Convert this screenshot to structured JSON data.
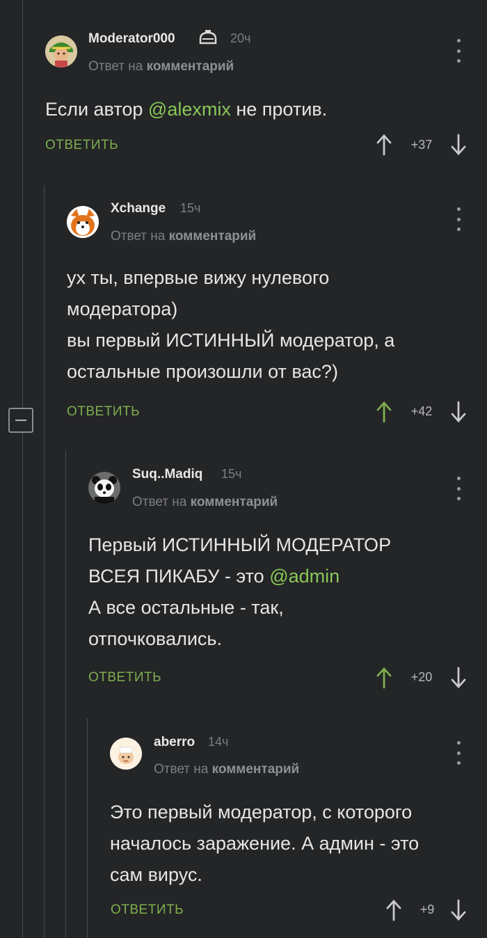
{
  "reply_label": "ОТВЕТИТЬ",
  "reply_prefix": "Ответ на",
  "reply_target": "комментарий",
  "comments": [
    {
      "username": "Moderator000",
      "time": "20ч",
      "lines": [
        "Если автор ",
        "@alexmix",
        " не против."
      ],
      "score": "+37"
    },
    {
      "username": "Xchange",
      "time": "15ч",
      "lines": [
        "ух ты, впервые вижу нулевого",
        "модератора)",
        "вы первый ИСТИННЫЙ модератор, а",
        "остальные произошли от вас?)"
      ],
      "score": "+42"
    },
    {
      "username": "Suq..Madiq",
      "time": "15ч",
      "lines": [
        "Первый ИСТИННЫЙ МОДЕРАТОР",
        "ВСЕЯ ПИКАБУ - это ",
        "@admin",
        "А все остальные - так,",
        "отпочковались."
      ],
      "score": "+20"
    },
    {
      "username": "aberro",
      "time": "14ч",
      "lines": [
        "Это первый модератор, с которого",
        "началось заражение. А админ - это",
        "сам вирус."
      ],
      "score": "+9"
    }
  ],
  "colors": {
    "background": "#232527",
    "accent_green": "#7fae4e",
    "mention_green": "#8ac858",
    "muted_text": "#7c7e80"
  }
}
